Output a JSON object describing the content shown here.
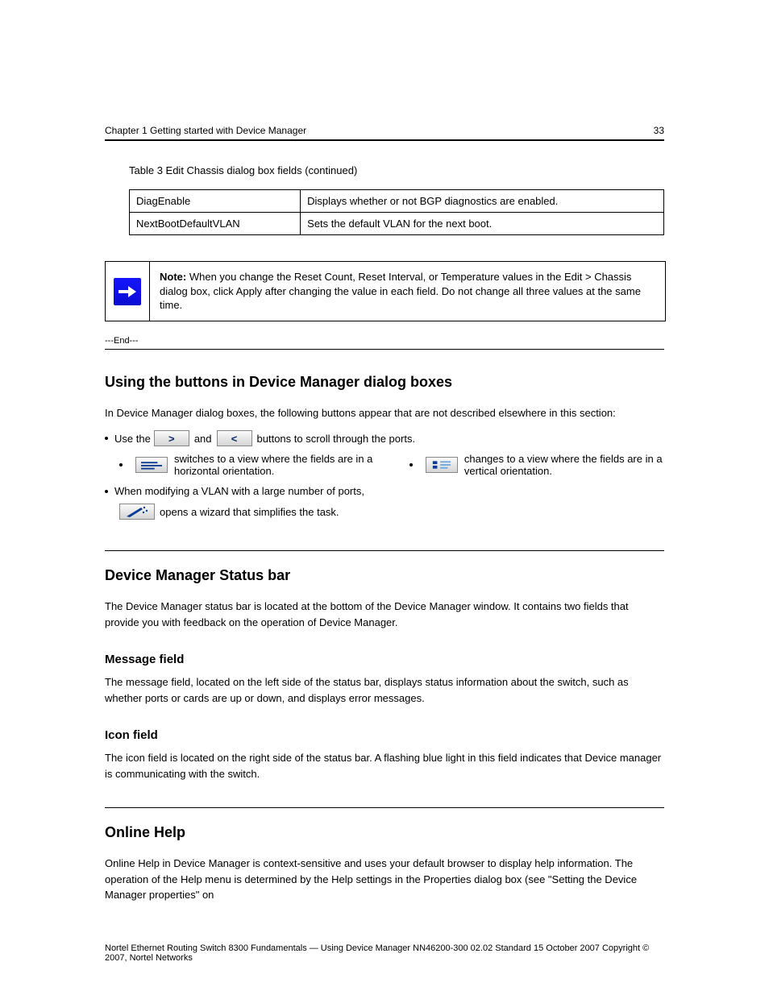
{
  "header": {
    "chapter": "Chapter 1 Getting started with Device Manager",
    "page": "33"
  },
  "tableSection": {
    "caption": "Table 3 Edit Chassis dialog box fields (continued)",
    "rows": [
      {
        "label": "DiagEnable",
        "desc": "Displays whether or not BGP diagnostics are enabled."
      },
      {
        "label": "NextBootDefaultVLAN",
        "desc": "Sets the default VLAN for the next boot."
      }
    ]
  },
  "note": {
    "label": "Note:",
    "sep": " ",
    "text": "When you change the Reset Count, Reset Interval, or Temperature values in the Edit > Chassis dialog box, click Apply after changing the value in each field. Do not change all three values at the same time."
  },
  "sections": {
    "endMarker": "---End---",
    "toolbar": {
      "title": "Using the buttons in Device Manager dialog boxes",
      "intro": "In Device Manager dialog boxes, the following buttons appear that are not described elsewhere in this section:",
      "bullets": [
        {
          "pre": "Use the ",
          "mid": " and ",
          "post": " buttons to scroll through the ports."
        },
        {
          "text": " switches to a view where the fields are in a horizontal orientation."
        },
        {
          "text": " changes to a view where the fields are in a vertical orientation."
        },
        {
          "pre": "When modifying a VLAN with a large number of ports,",
          "post": " opens a wizard that simplifies the task."
        }
      ]
    },
    "statusBar": {
      "title": "Device Manager Status bar",
      "p1": "The Device Manager status bar is located at the bottom of the Device Manager window. It contains two fields that provide you with feedback on the operation of Device Manager.",
      "sub1": {
        "title": "Message field",
        "text": "The message field, located on the left side of the status bar, displays status information about the switch, such as whether ports or cards are up or down, and displays error messages."
      },
      "sub2": {
        "title": "Icon field",
        "text": "The icon field is located on the right side of the status bar. A flashing blue light in this field indicates that Device manager is communicating with the switch."
      }
    },
    "onlineHelp": {
      "title": "Online Help",
      "text": "Online Help in Device Manager is context-sensitive and uses your default browser to display help information. The operation of the Help menu is determined by the Help settings in the Properties dialog box (see \"Setting the Device Manager properties\" on"
    }
  },
  "footer": {
    "text": "Nortel Ethernet Routing Switch 8300\nFundamentals — Using Device Manager\nNN46200-300 02.02 Standard\n15 October 2007\nCopyright © 2007, Nortel Networks"
  }
}
